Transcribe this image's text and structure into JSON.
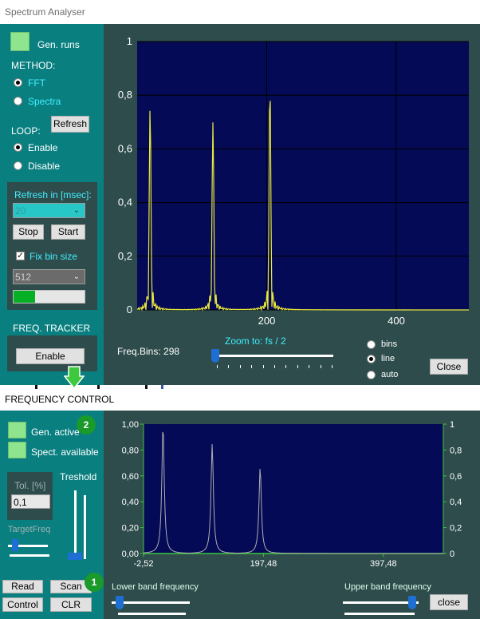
{
  "window": {
    "title": "Spectrum Analyser"
  },
  "left": {
    "gen_runs": "Gen. runs",
    "method_label": "METHOD:",
    "method_fft": "FFT",
    "method_spectra": "Spectra",
    "refresh_button": "Refresh",
    "loop_label": "LOOP:",
    "loop_enable": "Enable",
    "loop_disable": "Disable",
    "refresh_in_label": "Refresh in [msec]:",
    "refresh_value": "20",
    "stop_button": "Stop",
    "start_button": "Start",
    "fix_bin_label": "Fix bin size",
    "bin_size_value": "512",
    "progress_fraction": 0.3,
    "freq_tracker_label": "FREQ. TRACKER",
    "tracker_enable_button": "Enable"
  },
  "chart1": {
    "freq_bins": "Freq.Bins: 298",
    "zoom_label": "Zoom to: fs / 2",
    "display_bins": "bins",
    "display_line": "line",
    "display_auto": "auto",
    "close_button": "Close",
    "yticks": [
      "0",
      "0,2",
      "0,4",
      "0,6",
      "0,8",
      "1"
    ],
    "xticks": [
      "200",
      "400"
    ]
  },
  "freq_control": {
    "title": "FREQUENCY CONTROL"
  },
  "lower": {
    "gen_active": "Gen. active",
    "spect_available": "Spect. available",
    "badge2": "2",
    "badge1": "1",
    "tol_label": "Tol. [%]",
    "tol_value": "0,1",
    "treshold_label": "Treshold",
    "target_freq_label": "TargetFreq",
    "read_button": "Read",
    "scan_button": "Scan",
    "control_button": "Control",
    "clr_button": "CLR",
    "lower_band_label": "Lower band frequency",
    "upper_band_label": "Upper band frequency",
    "close_button": "close"
  },
  "chart2": {
    "yticks_left": [
      "0,00",
      "0,20",
      "0,40",
      "0,60",
      "0,80",
      "1,00"
    ],
    "yticks_right": [
      "0",
      "0,2",
      "0,4",
      "0,6",
      "0,8",
      "1"
    ],
    "xticks": [
      "-2,52",
      "197,48",
      "397,48"
    ]
  },
  "colors": {
    "panel_teal": "#0a7f80",
    "chart_bg": "#040a55",
    "trace_yellow": "#e8e83a",
    "trace_gray": "#b0b0b0",
    "accent_cyan": "#3ff0ff"
  },
  "chart_data": [
    {
      "type": "line",
      "title": "",
      "xlabel": "",
      "ylabel": "",
      "xlim": [
        0,
        512
      ],
      "ylim": [
        0,
        1
      ],
      "grid": true,
      "series": [
        {
          "peaks": [
            {
              "x": 20,
              "y": 0.76
            },
            {
              "x": 117,
              "y": 0.7
            },
            {
              "x": 205,
              "y": 0.84
            }
          ]
        }
      ]
    },
    {
      "type": "line",
      "title": "",
      "xlabel": "",
      "ylabel": "",
      "xlim": [
        -2.52,
        497.48
      ],
      "ylim": [
        0,
        1
      ],
      "grid": false,
      "series": [
        {
          "peaks": [
            {
              "x": 30,
              "y": 1.0
            },
            {
              "x": 112,
              "y": 0.85
            },
            {
              "x": 192,
              "y": 0.67
            }
          ]
        }
      ]
    }
  ]
}
